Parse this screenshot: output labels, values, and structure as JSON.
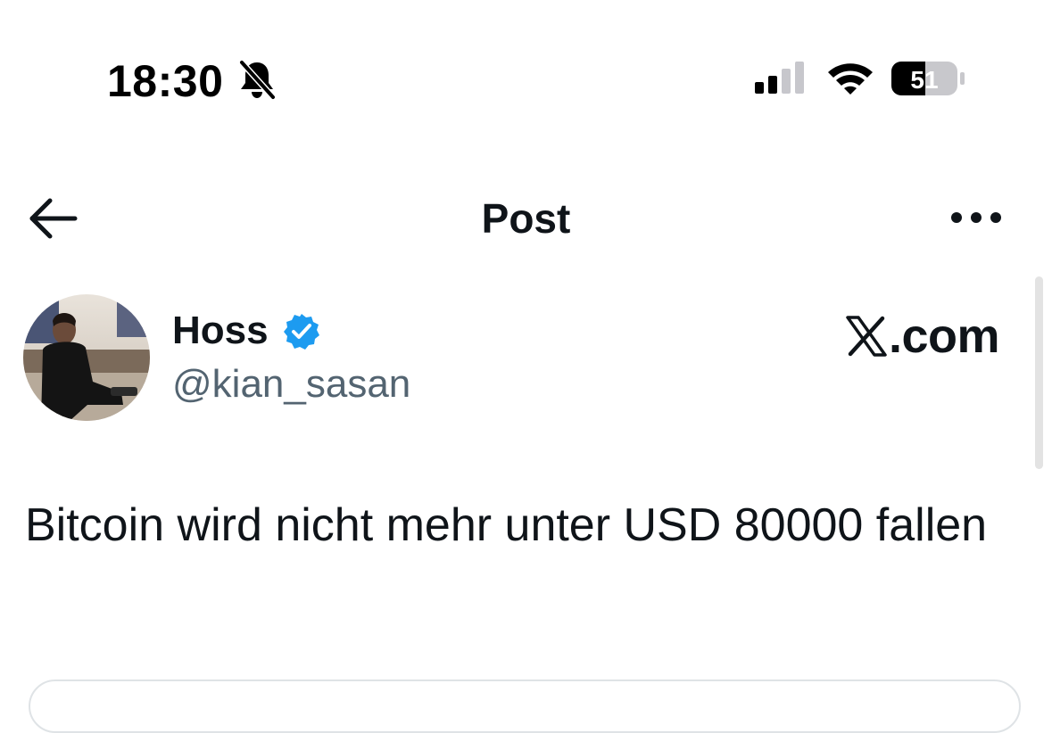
{
  "status_bar": {
    "time": "18:30",
    "silent_icon": "bell-slash-icon",
    "signal_icon": "cellular-signal-icon",
    "wifi_icon": "wifi-icon",
    "battery_level": "51",
    "battery_percent": 51
  },
  "nav": {
    "back_icon": "arrow-left-icon",
    "title": "Post",
    "more_icon": "more-horizontal-icon"
  },
  "post": {
    "author": {
      "display_name": "Hoss",
      "verified": true,
      "verified_icon": "verified-badge-icon",
      "handle": "@kian_sasan"
    },
    "watermark": "X.com",
    "watermark_parts": {
      "mark": "X",
      "suffix": ".com"
    },
    "text": "Bitcoin wird nicht mehr unter USD 80000 fallen"
  },
  "colors": {
    "text_primary": "#0f1419",
    "text_secondary": "#536471",
    "verified_blue": "#1d9bf0",
    "background": "#ffffff"
  }
}
